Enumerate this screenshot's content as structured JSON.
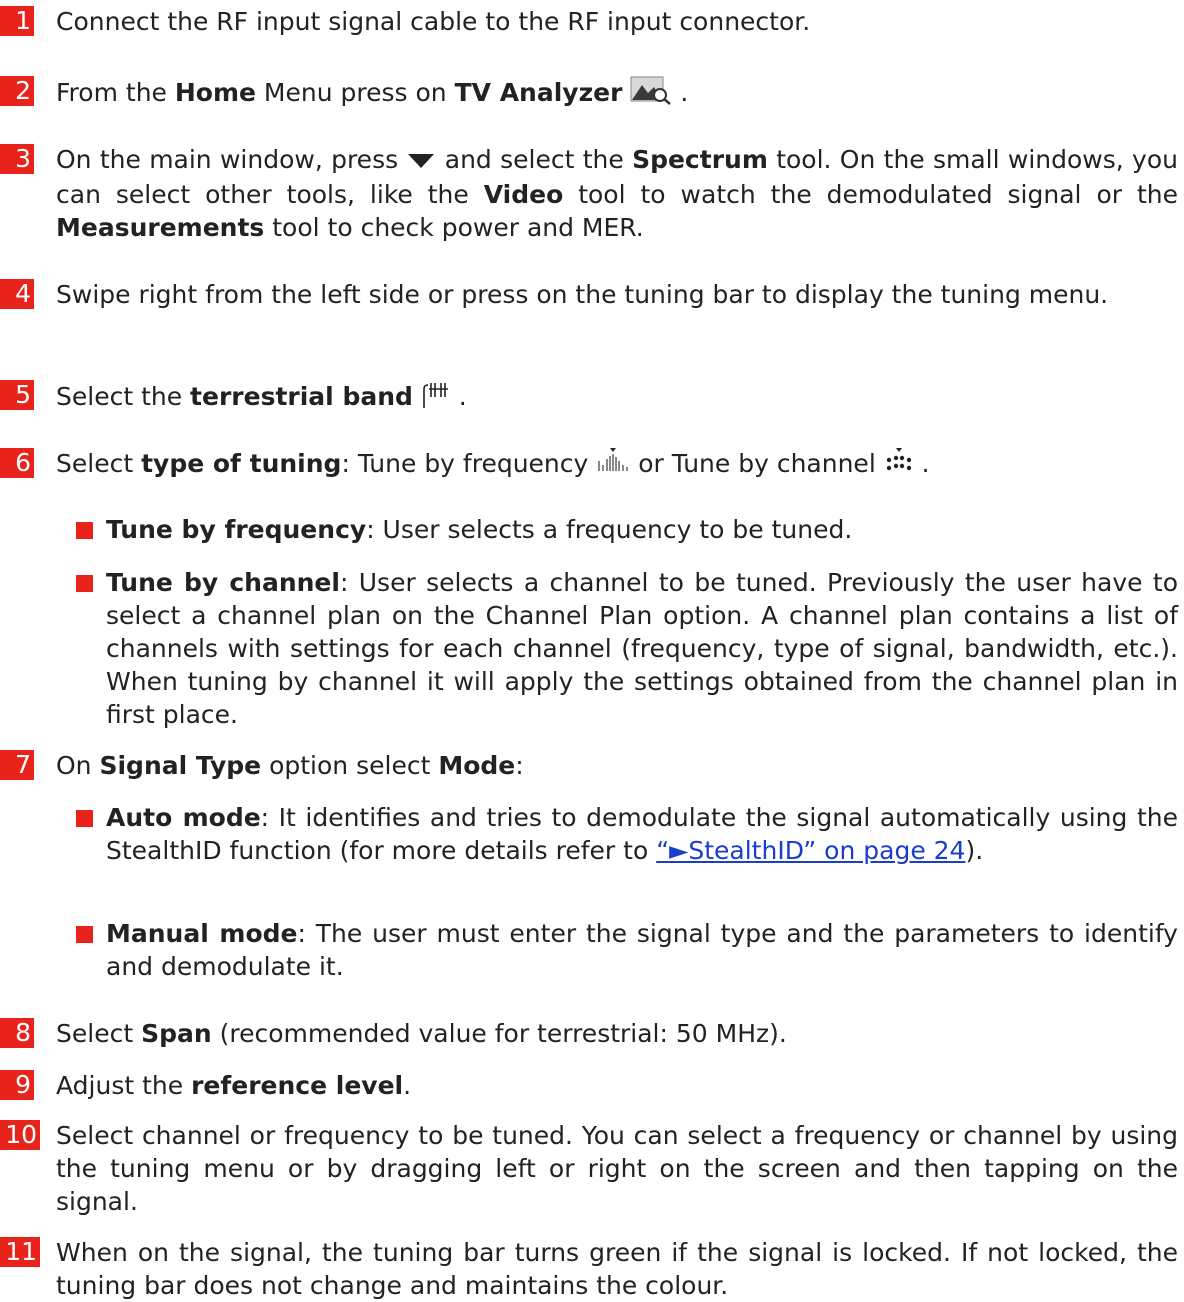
{
  "steps": [
    {
      "n": "1",
      "text": "Connect the RF input signal cable to the RF input connector."
    },
    {
      "n": "2",
      "pre": "From the ",
      "b1": "Home",
      "mid": " Menu press on ",
      "b2": "TV Analyzer",
      "post": " ."
    },
    {
      "n": "3",
      "p1": "On the main window, press ",
      "p2": " and select the ",
      "b1": "Spectrum",
      "p3": " tool. On the small windows, you can select other tools, like the ",
      "b2": "Video",
      "p4": " tool to watch the demodulated signal or the ",
      "b3": "Measurements",
      "p5": " tool to check power and MER."
    },
    {
      "n": "4",
      "text": "Swipe right from the left side or press on the tuning bar to display the tuning menu."
    },
    {
      "n": "5",
      "pre": "Select the ",
      "b1": "terrestrial band",
      "post": " ."
    },
    {
      "n": "6",
      "pre": "Select ",
      "b1": "type of tuning",
      "mid": ": Tune by frequency ",
      "mid2": " or Tune by channel ",
      "post": " ."
    },
    {
      "n": "7",
      "pre": " On ",
      "b1": "Signal Type",
      "mid": " option select ",
      "b2": "Mode",
      "post": ":"
    },
    {
      "n": "8",
      "pre": " Select ",
      "b1": "Span",
      "post": " (recommended value for terrestrial: 50 MHz)."
    },
    {
      "n": "9",
      "pre": " Adjust the ",
      "b1": "reference level",
      "post": "."
    },
    {
      "n": "10",
      "text": "Select channel or frequency to be tuned. You can select a frequency or channel by using the tuning menu or by dragging left or right on the screen and then tapping on the signal."
    },
    {
      "n": "11",
      "text": "When on the signal, the tuning bar turns green if the signal is locked. If not locked, the tuning bar does not change and maintains the colour."
    }
  ],
  "bullets6": [
    {
      "b": "Tune by frequency",
      "t": ": User selects a frequency to be tuned."
    },
    {
      "b": "Tune by channel",
      "t": ": User selects a channel to be tuned. Previously the user have to select a channel plan on the Channel Plan option. A channel plan contains a list of channels with settings for each channel (frequency, type of signal, bandwidth, etc.). When tuning by channel it will apply the settings obtained from the channel plan in first place."
    }
  ],
  "bullets7": [
    {
      "b": "Auto mode",
      "t": ": It identifies and tries to demodulate the signal automatically using the StealthID function (for more details refer to ",
      "link": "“►StealthID” on page 24",
      "t2": ")."
    },
    {
      "b": "Manual mode",
      "t": ": The user must enter the signal type and the parameters to identify and demodulate it."
    }
  ],
  "colors": {
    "accent": "#e8231b",
    "link": "#1a3dcc"
  },
  "icons": {
    "tv_analyzer": "tv-analyzer-icon",
    "dropdown": "triangle-down-icon",
    "terrestrial": "terrestrial-band-icon",
    "tune_freq": "tune-frequency-icon",
    "tune_chan": "tune-channel-icon"
  }
}
